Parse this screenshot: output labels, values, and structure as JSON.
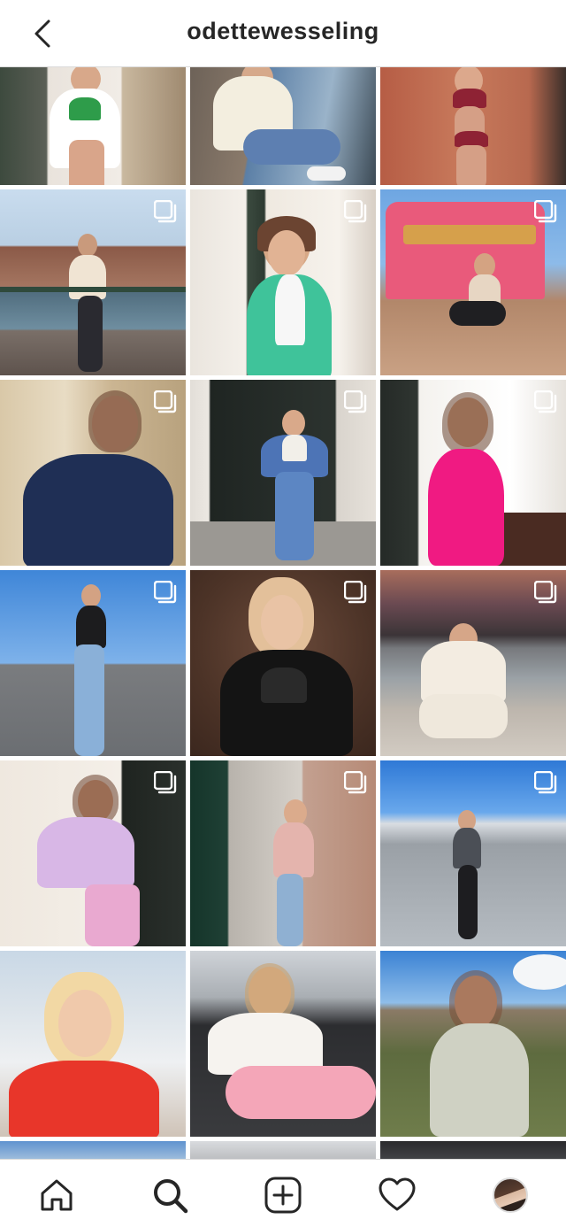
{
  "header": {
    "title": "odettewesseling"
  },
  "grid": {
    "posts": [
      {
        "id": 1,
        "multi": false
      },
      {
        "id": 2,
        "multi": false
      },
      {
        "id": 3,
        "multi": false
      },
      {
        "id": 4,
        "multi": true
      },
      {
        "id": 5,
        "multi": true
      },
      {
        "id": 6,
        "multi": true
      },
      {
        "id": 7,
        "multi": true
      },
      {
        "id": 8,
        "multi": true
      },
      {
        "id": 9,
        "multi": true
      },
      {
        "id": 10,
        "multi": true
      },
      {
        "id": 11,
        "multi": true
      },
      {
        "id": 12,
        "multi": true
      },
      {
        "id": 13,
        "multi": true
      },
      {
        "id": 14,
        "multi": true
      },
      {
        "id": 15,
        "multi": true
      },
      {
        "id": 16,
        "multi": false
      },
      {
        "id": 17,
        "multi": false
      },
      {
        "id": 18,
        "multi": false
      },
      {
        "id": 19,
        "multi": false
      },
      {
        "id": 20,
        "multi": false
      },
      {
        "id": 21,
        "multi": false
      }
    ]
  },
  "tabbar": {
    "tabs": [
      "home-icon",
      "search-icon",
      "new-post-icon",
      "heart-icon",
      "profile-avatar"
    ],
    "active": "search-icon"
  },
  "colors": {
    "text": "#262626",
    "divider": "#dbdbdb",
    "background": "#ffffff"
  }
}
